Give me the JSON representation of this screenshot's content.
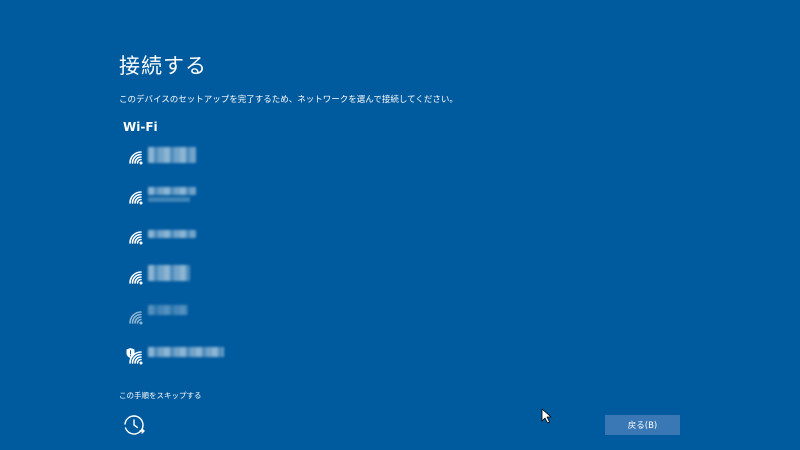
{
  "header": {
    "title": "接続する",
    "instructions": "このデバイスのセットアップを完了するため、ネットワークを選んで接続してください。"
  },
  "wifi_section": {
    "heading": "Wi-Fi",
    "networks": [
      {
        "icon": "wifi-signal-icon",
        "signal": "strong",
        "secured": false
      },
      {
        "icon": "wifi-signal-icon",
        "signal": "strong",
        "secured": false
      },
      {
        "icon": "wifi-signal-icon",
        "signal": "strong",
        "secured": false
      },
      {
        "icon": "wifi-signal-icon",
        "signal": "strong",
        "secured": false
      },
      {
        "icon": "wifi-signal-icon",
        "signal": "weak",
        "secured": false
      },
      {
        "icon": "wifi-shield-icon",
        "signal": "strong",
        "secured": true
      }
    ]
  },
  "footer": {
    "skip_label": "この手順をスキップする",
    "accessibility_icon": "ease-of-access-icon",
    "back_label": "戻る(B)"
  },
  "colors": {
    "background": "#005a9e",
    "button": "#3a78b5",
    "text": "#ffffff"
  }
}
